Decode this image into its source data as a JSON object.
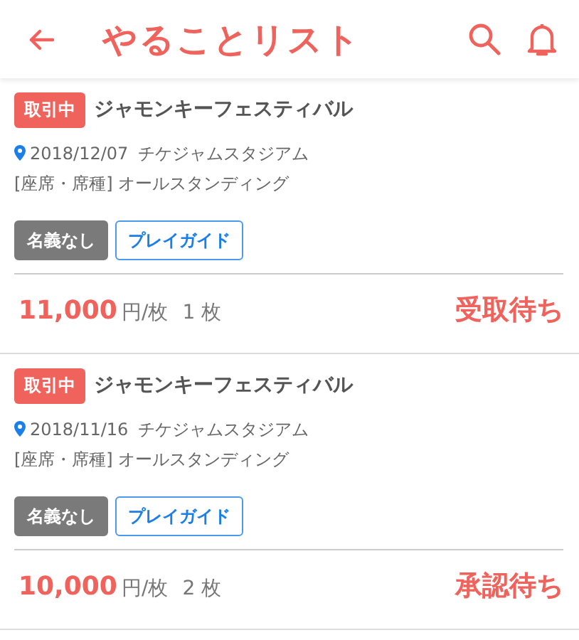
{
  "header": {
    "title": "やることリスト"
  },
  "items": [
    {
      "badge": "取引中",
      "title": "ジャモンキーフェスティバル",
      "date": "2018/12/07",
      "venue": "チケジャムスタジアム",
      "seat": "[座席・席種] オールスタンディング",
      "tags": [
        {
          "label": "名義なし",
          "kind": "filled"
        },
        {
          "label": "プレイガイド",
          "kind": "outline"
        }
      ],
      "price": "11,000",
      "unit": "円/枚",
      "quantity": "1 枚",
      "status": "受取待ち"
    },
    {
      "badge": "取引中",
      "title": "ジャモンキーフェスティバル",
      "date": "2018/11/16",
      "venue": "チケジャムスタジアム",
      "seat": "[座席・席種] オールスタンディング",
      "tags": [
        {
          "label": "名義なし",
          "kind": "filled"
        },
        {
          "label": "プレイガイド",
          "kind": "outline"
        }
      ],
      "price": "10,000",
      "unit": "円/枚",
      "quantity": "2 枚",
      "status": "承認待ち"
    }
  ]
}
